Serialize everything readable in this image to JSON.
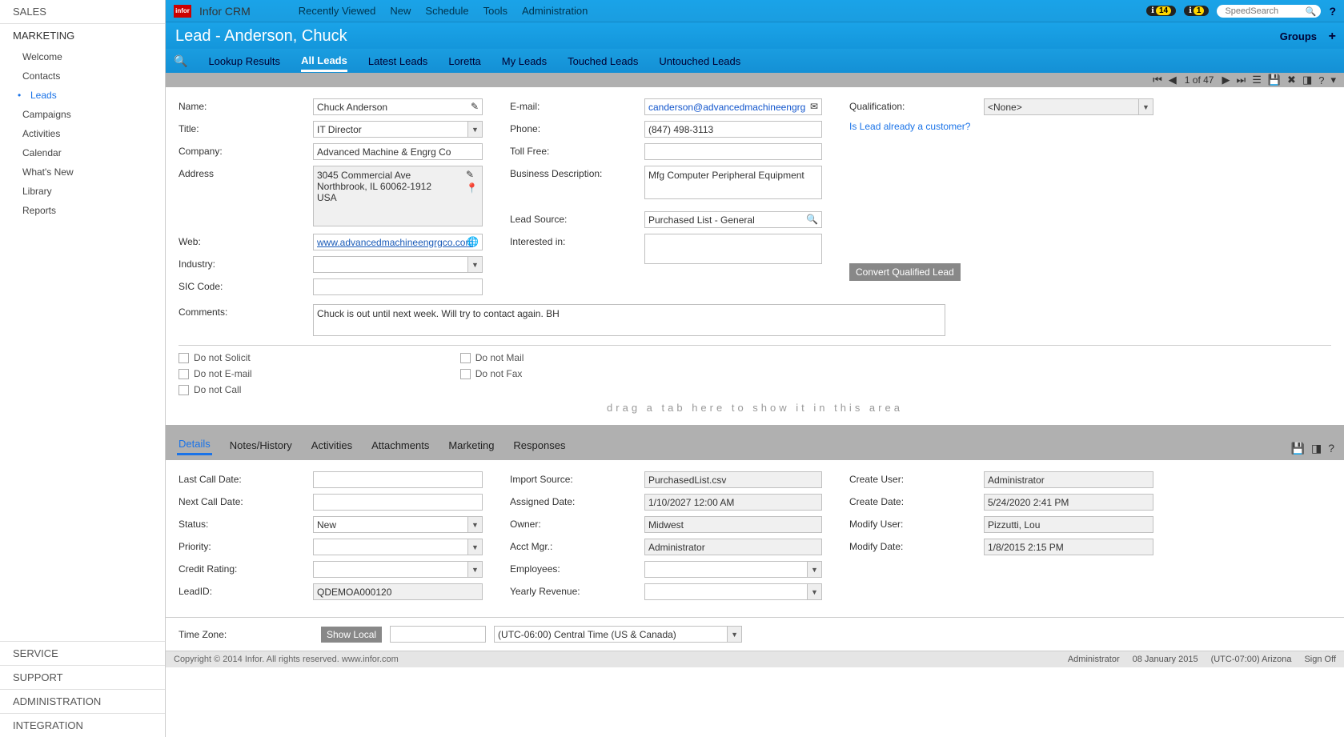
{
  "app": {
    "name": "Infor CRM",
    "logo_text": "infor"
  },
  "topmenu": [
    "Recently Viewed",
    "New",
    "Schedule",
    "Tools",
    "Administration"
  ],
  "notifications": {
    "count1": "14",
    "count2": "1"
  },
  "search": {
    "placeholder": "SpeedSearch"
  },
  "sidebar": {
    "top_header": "SALES",
    "active_header": "MARKETING",
    "items": [
      "Welcome",
      "Contacts",
      "Leads",
      "Campaigns",
      "Activities",
      "Calendar",
      "What's New",
      "Library",
      "Reports"
    ],
    "active_index": 2,
    "bottom": [
      "SERVICE",
      "SUPPORT",
      "ADMINISTRATION",
      "INTEGRATION"
    ]
  },
  "page": {
    "title": "Lead - Anderson, Chuck",
    "groups_label": "Groups"
  },
  "tabs": {
    "items": [
      "Lookup Results",
      "All Leads",
      "Latest Leads",
      "Loretta",
      "My Leads",
      "Touched Leads",
      "Untouched Leads"
    ],
    "active_index": 1
  },
  "pager": {
    "text": "1 of 47"
  },
  "form": {
    "name_label": "Name:",
    "name_value": "Chuck Anderson",
    "title_label": "Title:",
    "title_value": "IT Director",
    "company_label": "Company:",
    "company_value": "Advanced Machine & Engrg Co",
    "address_label": "Address",
    "address_value": "3045 Commercial Ave\nNorthbrook, IL 60062-1912\nUSA",
    "web_label": "Web:",
    "web_value": "www.advancedmachineengrgco.com",
    "industry_label": "Industry:",
    "industry_value": "",
    "sic_label": "SIC Code:",
    "sic_value": "",
    "comments_label": "Comments:",
    "comments_value": "Chuck is out until next week. Will try to contact again. BH",
    "email_label": "E-mail:",
    "email_value": "canderson@advancedmachineengrg",
    "phone_label": "Phone:",
    "phone_value": "(847) 498-3113",
    "tollfree_label": "Toll Free:",
    "tollfree_value": "",
    "bizdesc_label": "Business Description:",
    "bizdesc_value": "Mfg Computer Peripheral Equipment",
    "leadsource_label": "Lead Source:",
    "leadsource_value": "Purchased List - General",
    "interested_label": "Interested in:",
    "interested_value": "",
    "qualification_label": "Qualification:",
    "qualification_value": "<None>",
    "is_customer_link": "Is Lead already a customer?",
    "convert_button": "Convert Qualified Lead"
  },
  "donot": {
    "solicit": "Do not Solicit",
    "email": "Do not E-mail",
    "call": "Do not Call",
    "mail": "Do not Mail",
    "fax": "Do not Fax"
  },
  "drag_text": "drag a tab here to show it in this area",
  "details_tabs": [
    "Details",
    "Notes/History",
    "Activities",
    "Attachments",
    "Marketing",
    "Responses"
  ],
  "details": {
    "lastcall_label": "Last Call Date:",
    "lastcall_value": "",
    "nextcall_label": "Next Call Date:",
    "nextcall_value": "",
    "status_label": "Status:",
    "status_value": "New",
    "priority_label": "Priority:",
    "priority_value": "",
    "credit_label": "Credit Rating:",
    "credit_value": "",
    "leadid_label": "LeadID:",
    "leadid_value": "QDEMOA000120",
    "importsource_label": "Import Source:",
    "importsource_value": "PurchasedList.csv",
    "assigned_label": "Assigned Date:",
    "assigned_value": "1/10/2027 12:00 AM",
    "owner_label": "Owner:",
    "owner_value": "Midwest",
    "acctmgr_label": "Acct Mgr.:",
    "acctmgr_value": "Administrator",
    "employees_label": "Employees:",
    "employees_value": "",
    "revenue_label": "Yearly Revenue:",
    "revenue_value": "",
    "createuser_label": "Create User:",
    "createuser_value": "Administrator",
    "createdate_label": "Create Date:",
    "createdate_value": "5/24/2020 2:41 PM",
    "modifyuser_label": "Modify User:",
    "modifyuser_value": "Pizzutti, Lou",
    "modifydate_label": "Modify Date:",
    "modifydate_value": "1/8/2015 2:15 PM"
  },
  "timezone": {
    "label": "Time Zone:",
    "show_local": "Show Local",
    "value": "(UTC-06:00) Central Time (US & Canada)"
  },
  "footer": {
    "copyright": "Copyright © 2014 Infor. All rights reserved. www.infor.com",
    "user": "Administrator",
    "date": "08 January 2015",
    "tz": "(UTC-07:00) Arizona",
    "signoff": "Sign Off"
  }
}
